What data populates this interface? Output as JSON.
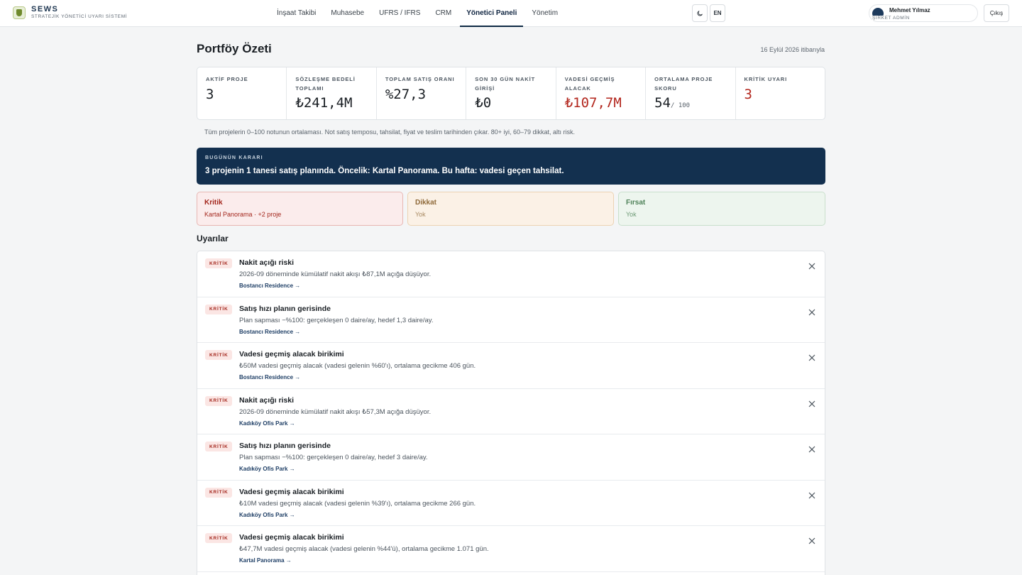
{
  "brand": {
    "name": "SEWS",
    "subtitle": "STRATEJİK YÖNETİCİ UYARI SİSTEMİ"
  },
  "nav": [
    "İnşaat Takibi",
    "Muhasebe",
    "UFRS / IFRS",
    "CRM",
    "Yönetici Paneli",
    "Yönetim"
  ],
  "nav_active": "Yönetici Paneli",
  "header_controls": {
    "theme_icon": "moon-icon",
    "language": "EN"
  },
  "user": {
    "name": "Mehmet Yılmaz",
    "role": "ŞİRKET ADMİN",
    "logout": "Çıkış"
  },
  "page": {
    "title": "Portföy Özeti",
    "date": "16 Eylül 2026 itibarıyla"
  },
  "kpis": [
    {
      "label": "AKTİF PROJE",
      "value": "3",
      "suffix": "",
      "alert": false
    },
    {
      "label": "SÖZLEŞME BEDELİ TOPLAMI",
      "value": "₺241,4M",
      "suffix": "",
      "alert": false
    },
    {
      "label": "TOPLAM SATIŞ ORANI",
      "value": "%27,3",
      "suffix": "",
      "alert": false
    },
    {
      "label": "SON 30 GÜN NAKİT GİRİŞİ",
      "value": "₺0",
      "suffix": "",
      "alert": false
    },
    {
      "label": "VADESİ GEÇMİŞ ALACAK",
      "value": "₺107,7M",
      "suffix": "",
      "alert": true
    },
    {
      "label": "ORTALAMA PROJE SKORU",
      "value": "54",
      "suffix": "/ 100",
      "alert": false
    },
    {
      "label": "KRİTİK UYARI",
      "value": "3",
      "suffix": "",
      "alert": true
    }
  ],
  "score_note": "Tüm projelerin 0–100 notunun ortalaması. Not satış temposu, tahsilat, fiyat ve teslim tarihinden çıkar. 80+ iyi, 60–79 dikkat, altı risk.",
  "decision": {
    "kicker": "BUGÜNÜN KARARI",
    "text": "3 projenin 1 tanesi satış planında. Öncelik: Kartal Panorama. Bu hafta: vadesi geçen tahsilat."
  },
  "status_cards": {
    "critical": {
      "title": "Kritik",
      "body": "Kartal Panorama · +2 proje"
    },
    "warning": {
      "title": "Dikkat",
      "body": "Yok"
    },
    "opportunity": {
      "title": "Fırsat",
      "body": "Yok"
    }
  },
  "alerts_title": "Uyarılar",
  "alerts": [
    {
      "badge": "KRİTİK",
      "title": "Nakit açığı riski",
      "desc": "2026-09 döneminde kümülatif nakit akışı ₺87,1M açığa düşüyor.",
      "link": "Bostancı Residence →"
    },
    {
      "badge": "KRİTİK",
      "title": "Satış hızı planın gerisinde",
      "desc": "Plan sapması −%100: gerçekleşen 0 daire/ay, hedef 1,3 daire/ay.",
      "link": "Bostancı Residence →"
    },
    {
      "badge": "KRİTİK",
      "title": "Vadesi geçmiş alacak birikimi",
      "desc": "₺50M vadesi geçmiş alacak (vadesi gelenin %60'ı), ortalama gecikme 406 gün.",
      "link": "Bostancı Residence →"
    },
    {
      "badge": "KRİTİK",
      "title": "Nakit açığı riski",
      "desc": "2026-09 döneminde kümülatif nakit akışı ₺57,3M açığa düşüyor.",
      "link": "Kadıköy Ofis Park →"
    },
    {
      "badge": "KRİTİK",
      "title": "Satış hızı planın gerisinde",
      "desc": "Plan sapması −%100: gerçekleşen 0 daire/ay, hedef 3 daire/ay.",
      "link": "Kadıköy Ofis Park →"
    },
    {
      "badge": "KRİTİK",
      "title": "Vadesi geçmiş alacak birikimi",
      "desc": "₺10M vadesi geçmiş alacak (vadesi gelenin %39'ı), ortalama gecikme 266 gün.",
      "link": "Kadıköy Ofis Park →"
    },
    {
      "badge": "KRİTİK",
      "title": "Vadesi geçmiş alacak birikimi",
      "desc": "₺47,7M vadesi geçmiş alacak (vadesi gelenin %44'ü), ortalama gecikme 1.071 gün.",
      "link": "Kartal Panorama →"
    }
  ],
  "colors": {
    "navy": "#13304f",
    "critical": "#a3261c",
    "warning": "#8f6a3a",
    "opportunity": "#4e8158"
  }
}
